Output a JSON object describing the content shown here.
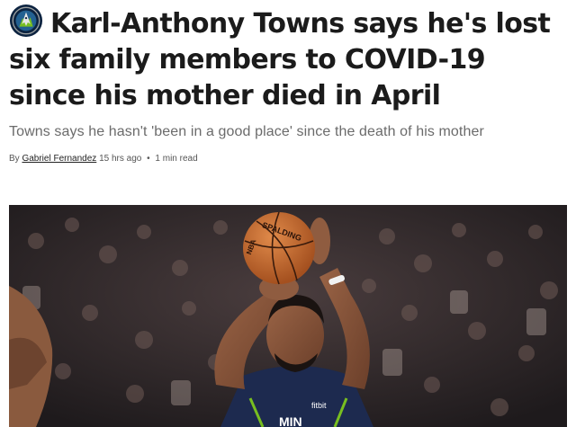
{
  "article": {
    "headline": "Karl-Anthony Towns says he's lost six family members to COVID-19 since his mother died in April",
    "subtitle": "Towns says he hasn't 'been in a good place' since the death of his mother",
    "byline": {
      "prefix": "By",
      "author": "Gabriel Fernandez",
      "time": "15 hrs ago",
      "separator": "•",
      "read_time": "1 min read"
    },
    "photo": {
      "ball_text": "SPALDING",
      "ball_text_2": "NBA",
      "jersey_sponsor": "fitbit",
      "jersey_text": "MIN"
    }
  },
  "colors": {
    "headline": "#1b1b1b",
    "subtitle": "#6b6b6b",
    "logo_navy": "#0c2340",
    "logo_green": "#78be20",
    "jersey_navy": "#1d2a4f"
  },
  "icons": {
    "team_logo": "timberwolves-logo-icon"
  }
}
